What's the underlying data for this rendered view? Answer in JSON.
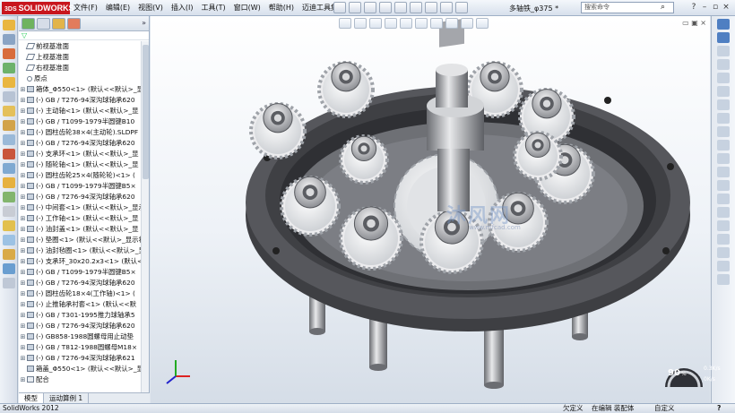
{
  "app": {
    "logo": "SOLIDWORKS",
    "document_title": "多轴铁_φ375 *",
    "search_placeholder": "搜索命令"
  },
  "menu": [
    "文件(F)",
    "编辑(E)",
    "视图(V)",
    "插入(I)",
    "工具(T)",
    "窗口(W)",
    "帮助(H)",
    "迈迪工具集"
  ],
  "feature_tree": {
    "filter": "▽",
    "collapse": "»",
    "items": [
      {
        "label": "前视基准面",
        "type": "plane",
        "expandable": false
      },
      {
        "label": "上视基准面",
        "type": "plane",
        "expandable": false
      },
      {
        "label": "右视基准面",
        "type": "plane",
        "expandable": false
      },
      {
        "label": "原点",
        "type": "origin",
        "expandable": false
      },
      {
        "label": "箱体_Φ550<1> (默认<<默认>_显",
        "type": "part",
        "expandable": true
      },
      {
        "label": "(-) GB / T276-94深沟球轴承620",
        "type": "part",
        "expandable": true
      },
      {
        "label": "(-) 主动轴<1> (默认<<默认>_显",
        "type": "part",
        "expandable": true
      },
      {
        "label": "(-) GB / T1099-1979半圆键B10",
        "type": "part",
        "expandable": true
      },
      {
        "label": "(-) 圆柱齿轮38×4(主动轮).SLDPF",
        "type": "part",
        "expandable": true
      },
      {
        "label": "(-) GB / T276-94深沟球轴承620",
        "type": "part",
        "expandable": true
      },
      {
        "label": "(-) 支承环<1> (默认<<默认>_显",
        "type": "part",
        "expandable": true
      },
      {
        "label": "(-) 随轮轴<1> (默认<<默认>_显",
        "type": "part",
        "expandable": true
      },
      {
        "label": "(-) 圆柱齿轮25×4(随轮轮)<1> (",
        "type": "part",
        "expandable": true
      },
      {
        "label": "(-) GB / T1099-1979半圆键B5×",
        "type": "part",
        "expandable": true
      },
      {
        "label": "(-) GB / T276-94深沟球轴承620",
        "type": "part",
        "expandable": true
      },
      {
        "label": "(-) 中间套<1> (默认<<默认>_显示",
        "type": "part",
        "expandable": true
      },
      {
        "label": "(-) 工作轴<1> (默认<<默认>_显",
        "type": "part",
        "expandable": true
      },
      {
        "label": "(-) 油封盖<1> (默认<<默认>_显",
        "type": "part",
        "expandable": true
      },
      {
        "label": "(-) 垫圈<1> (默认<<默认>_显示状",
        "type": "part",
        "expandable": true
      },
      {
        "label": "(-) 油封毡圈<1> (默认<<默认>_显",
        "type": "part",
        "expandable": true
      },
      {
        "label": "(-) 支承环_30x20.2x3<1> (默认<",
        "type": "part",
        "expandable": true
      },
      {
        "label": "(-) GB / T1099-1979半圆键B5×",
        "type": "part",
        "expandable": true
      },
      {
        "label": "(-) GB / T276-94深沟球轴承620",
        "type": "part",
        "expandable": true
      },
      {
        "label": "(-) 圆柱齿轮18×4(工作轴)<1> (",
        "type": "part",
        "expandable": true
      },
      {
        "label": "(-) 止推轴承衬套<1> (默认<<默",
        "type": "part",
        "expandable": true
      },
      {
        "label": "(-) GB / T301-1995推力球轴承5",
        "type": "part",
        "expandable": true
      },
      {
        "label": "(-) GB / T276-94深沟球轴承620",
        "type": "part",
        "expandable": true
      },
      {
        "label": "(-) GB858-1988圆螺母用止动垫",
        "type": "part",
        "expandable": true
      },
      {
        "label": "(-) GB / T812-1988圆螺母M18×",
        "type": "part",
        "expandable": true
      },
      {
        "label": "(-) GB / T276-94深沟球轴承621",
        "type": "part",
        "expandable": true
      },
      {
        "label": "箱盖_Φ550<1> (默认<<默认>_显",
        "type": "part",
        "expandable": false
      },
      {
        "label": "配合",
        "type": "mate",
        "expandable": true
      }
    ]
  },
  "bottom_tabs": [
    "模型",
    "运动算例 1"
  ],
  "status": {
    "app": "SolidWorks 2012",
    "s1": "欠定义",
    "s2": "在编辑 装配体",
    "s3": "自定义",
    "help": "?"
  },
  "gauge": {
    "value": "90",
    "unit": "%",
    "sub1": "0.3K/s",
    "sub2": "0K/s"
  },
  "watermark": {
    "text": "沐风网",
    "sub": "www.mfcad.com"
  },
  "colors": {
    "logo_bg": "#c8161d",
    "part_dark": "#4a4a4e",
    "gear": "#e6e6e6",
    "bearing": "#b8b8bc"
  }
}
